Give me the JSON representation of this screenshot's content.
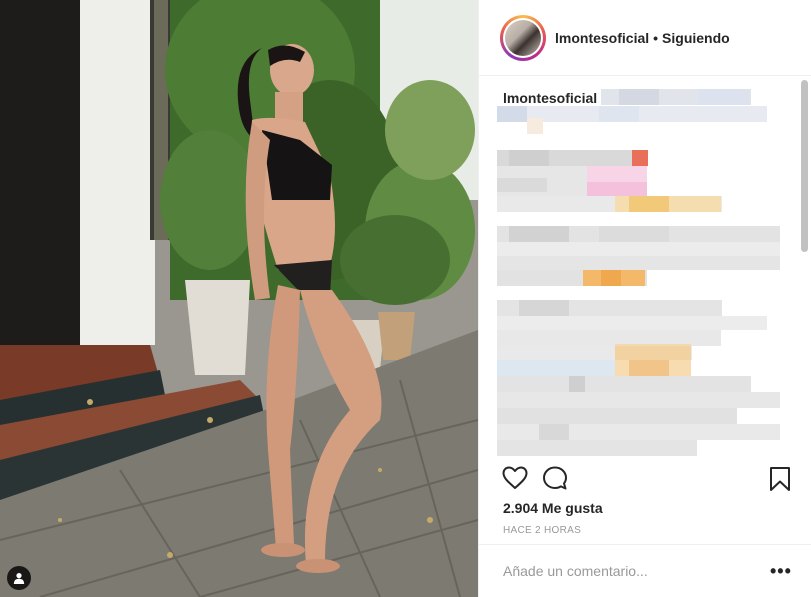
{
  "post": {
    "username": "lmontesoficial",
    "separator": "•",
    "follow_status": "Siguiendo",
    "caption_username": "lmontesoficial",
    "likes": "2.904 Me gusta",
    "timestamp": "HACE 2 HORAS",
    "comment_placeholder": "Añade un comentario...",
    "more_label": "•••"
  },
  "icons": {
    "like": "heart-icon",
    "comment": "comment-icon",
    "save": "bookmark-icon",
    "tag": "user-tag-icon"
  },
  "colors": {
    "text": "#262626",
    "muted": "#999999",
    "divider": "#efefef"
  }
}
